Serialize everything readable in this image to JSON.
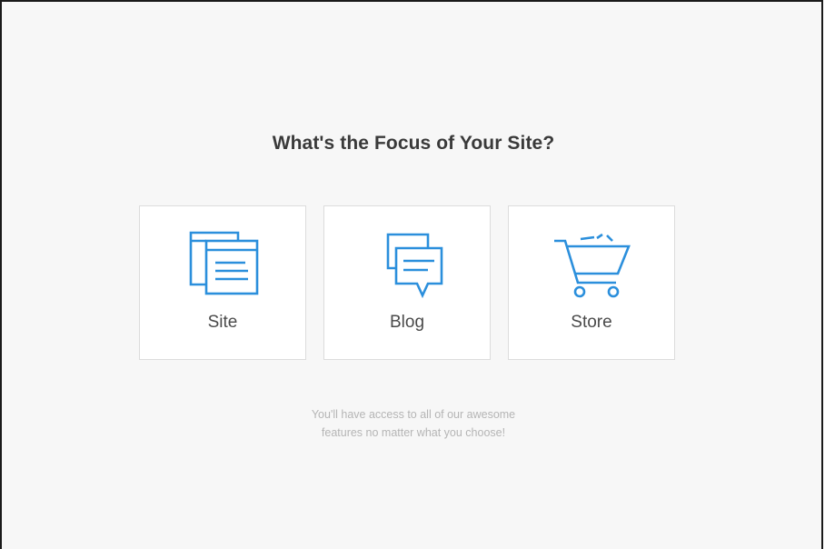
{
  "heading": "What's the Focus of Your Site?",
  "options": [
    {
      "label": "Site",
      "icon": "site-pages-icon"
    },
    {
      "label": "Blog",
      "icon": "blog-chat-icon"
    },
    {
      "label": "Store",
      "icon": "shopping-cart-icon"
    }
  ],
  "note": {
    "line1": "You'll have access to all of our awesome",
    "line2": "features no matter what you choose!"
  },
  "colors": {
    "accent": "#2b8fdc",
    "background": "#f7f7f7",
    "card": "#ffffff",
    "heading": "#3a3a3a",
    "note": "#b5b5b5"
  }
}
